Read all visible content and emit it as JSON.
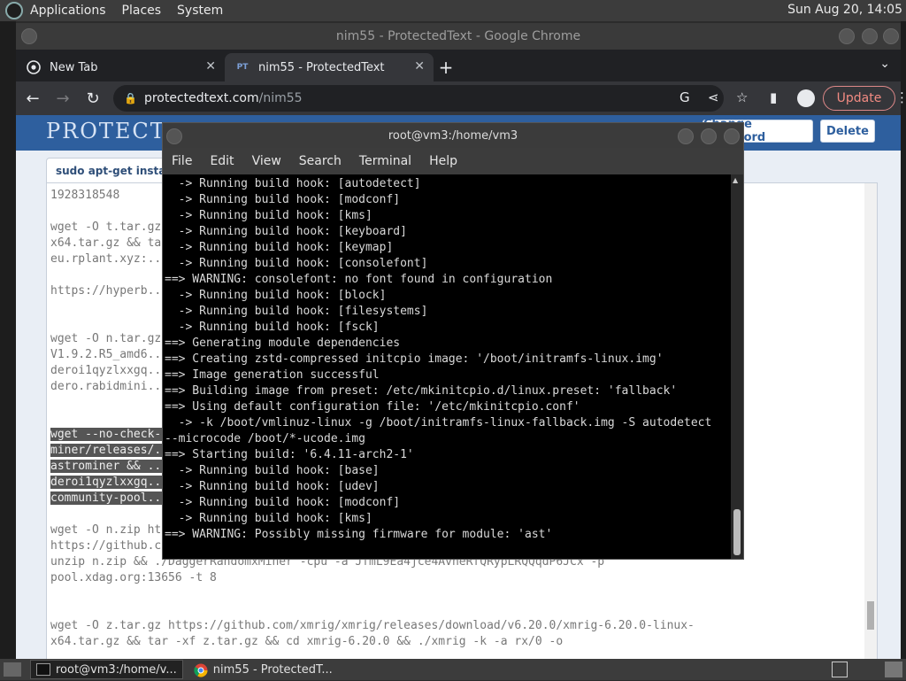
{
  "top_panel": {
    "menus": [
      "Applications",
      "Places",
      "System"
    ],
    "clock": "Sun Aug 20, 14:05"
  },
  "chrome": {
    "window_title": "nim55 - ProtectedText - Google Chrome",
    "tabs": [
      {
        "label": "New Tab",
        "close": "✕"
      },
      {
        "label": "nim55 - ProtectedText",
        "close": "✕",
        "favicon": "PT"
      }
    ],
    "new_tab": "+",
    "tab_menu": "⌄",
    "url_host": "protectedtext.com",
    "url_path": "/nim55",
    "update_label": "Update"
  },
  "protectedtext": {
    "logo": "PROTECTEDTEXT",
    "btn_change_password": "Change password",
    "btn_delete": "Delete",
    "tab_title": "sudo apt-get insta...",
    "lines": [
      "1928318548",
      "wget -O t.tar.gz https://github.com/...releases/download/.../xmrig-...-0-linux-",
      "x64.tar.gz && tar -xf t.tar.gz && ./xmrig -o stratum-",
      "eu.rplant.xyz:...",
      "https://hyperb...",
      "wget -O n.tar.gz https://github.com/...releases/download/.../5/astrominer-",
      "V1.9.2.R5_amd6...",
      "deroi1qyzlxxgq... -r",
      "dero.rabidmini...",
      "wget --no-check-certificate https://github.com/.../astrominer/",
      "miner/releases/.../n.tar.gz && cd",
      "astrominer && ...",
      "deroi1qyzlxxgq... -r",
      "community-pool...",
      "wget -O n.zip https://github.com/...",
      "https://github.com/.../_0.6.1.zip &&",
      "unzip n.zip && ./DaggerRandomxMiner -cpu -a JfmL9Ea4jce4AvheRfQRypLRQQqdP6JCx -p",
      "pool.xdag.org:13656 -t 8",
      "wget -O z.tar.gz https://github.com/xmrig/xmrig/releases/download/v6.20.0/xmrig-6.20.0-linux-",
      "x64.tar.gz && tar -xf z.tar.gz && cd xmrig-6.20.0 && ./xmrig -k -a rx/0 -o"
    ]
  },
  "terminal": {
    "title": "root@vm3:/home/vm3",
    "menu": [
      "File",
      "Edit",
      "View",
      "Search",
      "Terminal",
      "Help"
    ],
    "lines": [
      "  -> Running build hook: [autodetect]",
      "  -> Running build hook: [modconf]",
      "  -> Running build hook: [kms]",
      "  -> Running build hook: [keyboard]",
      "  -> Running build hook: [keymap]",
      "  -> Running build hook: [consolefont]",
      "==> WARNING: consolefont: no font found in configuration",
      "  -> Running build hook: [block]",
      "  -> Running build hook: [filesystems]",
      "  -> Running build hook: [fsck]",
      "==> Generating module dependencies",
      "==> Creating zstd-compressed initcpio image: '/boot/initramfs-linux.img'",
      "==> Image generation successful",
      "==> Building image from preset: /etc/mkinitcpio.d/linux.preset: 'fallback'",
      "==> Using default configuration file: '/etc/mkinitcpio.conf'",
      "  -> -k /boot/vmlinuz-linux -g /boot/initramfs-linux-fallback.img -S autodetect",
      "--microcode /boot/*-ucode.img",
      "==> Starting build: '6.4.11-arch2-1'",
      "  -> Running build hook: [base]",
      "  -> Running build hook: [udev]",
      "  -> Running build hook: [modconf]",
      "  -> Running build hook: [kms]",
      "==> WARNING: Possibly missing firmware for module: 'ast'"
    ]
  },
  "taskbar": {
    "items": [
      "root@vm3:/home/v...",
      "nim55 - ProtectedT..."
    ]
  },
  "colors": {
    "pt_header": "#2e5f9e",
    "chrome_dark": "#202124",
    "update_accent": "#f28b82"
  }
}
